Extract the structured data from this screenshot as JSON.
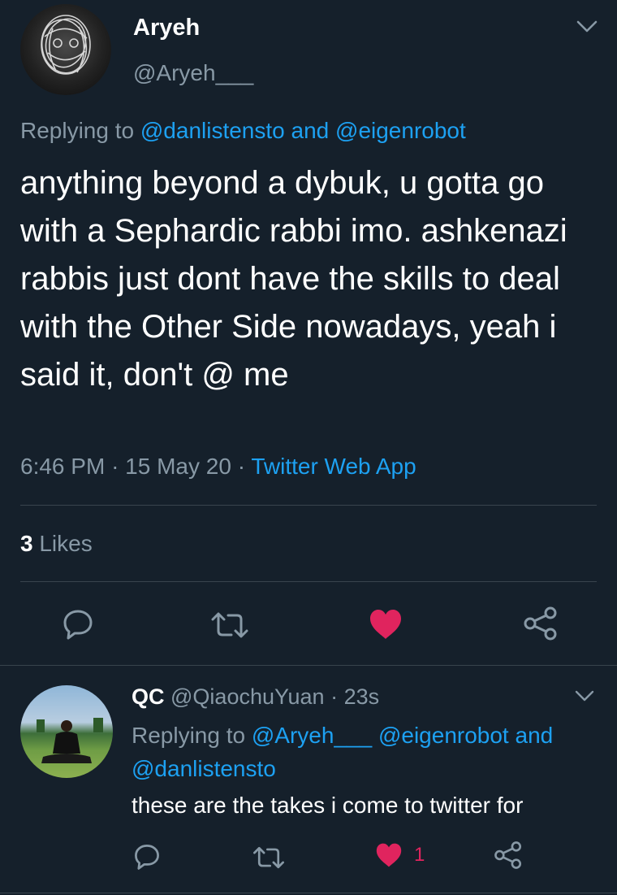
{
  "tweet": {
    "name": "Aryeh",
    "handle": "@Aryeh___",
    "replying_prefix": "Replying to",
    "replying_user1": "@danlistensto",
    "replying_and": "and",
    "replying_user2": "@eigenrobot",
    "text": "anything beyond a dybuk, u gotta go with a Sephardic rabbi imo. ashkenazi rabbis just dont have the skills to deal with the Other Side nowadays, yeah i said it, don't @ me",
    "time": "6:46 PM",
    "sep1": "·",
    "date": "15 May 20",
    "sep2": "·",
    "source": "Twitter Web App",
    "likes_count": "3",
    "likes_label": "Likes"
  },
  "reply": {
    "name": "QC",
    "handle": "@QiaochuYuan",
    "sep": "·",
    "age": "23s",
    "replying_prefix": "Replying to",
    "replying_user1": "@Aryeh___",
    "replying_user2": "@eigenrobot",
    "replying_and": "and",
    "replying_user3": "@danlistensto",
    "text": "these are the takes i come to twitter for",
    "like_count": "1"
  },
  "colors": {
    "background": "#15202b",
    "secondary_text": "#8899a6",
    "link": "#1da1f2",
    "like_active": "#e0245e",
    "divider": "#38444d"
  },
  "icons": [
    "reply-icon",
    "retweet-icon",
    "heart-icon",
    "share-icon",
    "chevron-down-icon"
  ]
}
